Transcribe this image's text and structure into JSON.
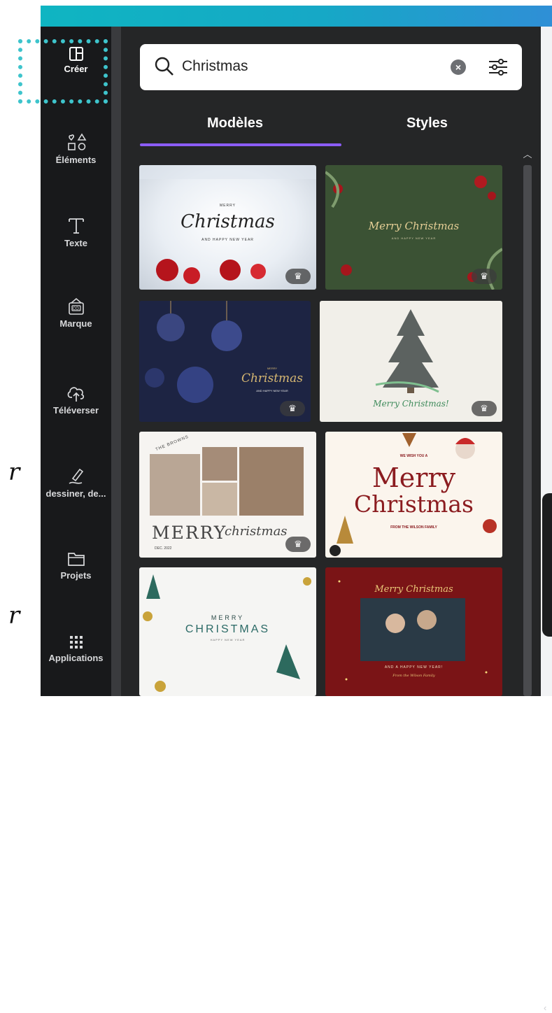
{
  "colors": {
    "accent": "#8b5cf6",
    "topbar": "#0fb5c2",
    "panel_bg": "#252627",
    "rail_bg": "#18191b"
  },
  "sidebar": {
    "items": [
      {
        "label": "Créer",
        "icon": "layout-panel-icon"
      },
      {
        "label": "Éléments",
        "icon": "shapes-icon"
      },
      {
        "label": "Texte",
        "icon": "text-T-icon"
      },
      {
        "label": "Marque",
        "icon": "brand-kit-icon"
      },
      {
        "label": "Téléverser",
        "icon": "cloud-upload-icon"
      },
      {
        "label": "dessiner, de...",
        "icon": "draw-pen-icon"
      },
      {
        "label": "Projets",
        "icon": "folder-icon"
      },
      {
        "label": "Applications",
        "icon": "apps-grid-icon"
      }
    ]
  },
  "search": {
    "query": "Christmas",
    "clear_icon": "clear-icon",
    "filter_icon": "filter-sliders-icon"
  },
  "tabs": [
    {
      "label": "Modèles",
      "active": true
    },
    {
      "label": "Styles",
      "active": false
    }
  ],
  "templates": [
    {
      "small": "MERRY",
      "script": "Christmas",
      "sub": "AND HAPPY NEW YEAR",
      "premium": true
    },
    {
      "script": "Merry Christmas",
      "sub": "AND HAPPY NEW YEAR",
      "premium": true
    },
    {
      "small": "MERRY",
      "script": "Christmas",
      "sub": "AND HAPPY NEW YEAR",
      "premium": true
    },
    {
      "script": "Merry Christmas!",
      "premium": true
    },
    {
      "arc": "THE BROWNS",
      "big": "MERRY",
      "script": "christmas",
      "date": "DEC. 2022",
      "premium": true
    },
    {
      "small": "WE WISH YOU A",
      "big1": "Merry",
      "big2": "Christmas",
      "sub": "FROM THE WILSON FAMILY",
      "premium": false
    },
    {
      "small": "MERRY",
      "big": "CHRISTMAS",
      "sub": "HAPPY NEW YEAR",
      "premium": false
    },
    {
      "script": "Merry Christmas",
      "sub": "AND A HAPPY NEW YEAR!",
      "sign": "From the Wilson Family",
      "premium": false
    }
  ],
  "crown_glyph": "♛",
  "margin_marks": [
    "r",
    "r"
  ]
}
